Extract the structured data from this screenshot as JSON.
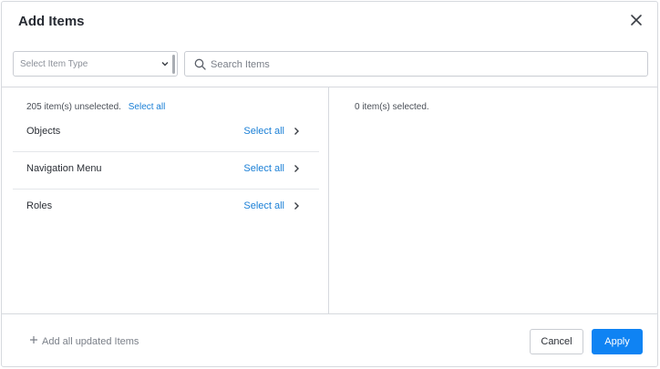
{
  "dialog": {
    "title": "Add Items",
    "close_icon": "close-icon"
  },
  "filters": {
    "item_type": {
      "placeholder": "Select Item Type",
      "selected": ""
    },
    "search": {
      "placeholder": "Search Items",
      "value": ""
    }
  },
  "left_pane": {
    "summary_text": "205 item(s) unselected.",
    "select_all_label": "Select all",
    "items": [
      {
        "label": "Objects",
        "select_all_label": "Select all"
      },
      {
        "label": "Navigation Menu",
        "select_all_label": "Select all"
      },
      {
        "label": "Roles",
        "select_all_label": "Select all"
      }
    ]
  },
  "right_pane": {
    "summary_text": "0 item(s) selected."
  },
  "footer": {
    "add_all_label": "Add all updated Items",
    "cancel_label": "Cancel",
    "apply_label": "Apply"
  },
  "colors": {
    "accent": "#0f83f3",
    "link": "#1a7fd6",
    "border": "#d6d9de"
  }
}
